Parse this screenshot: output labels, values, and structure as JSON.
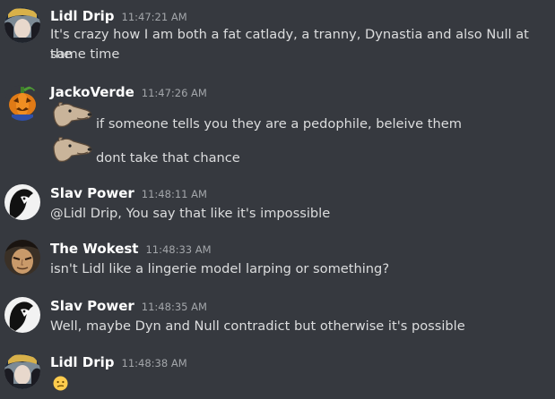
{
  "messages": [
    {
      "author": "Lidl Drip",
      "time": "11:47:21 AM",
      "lines": [
        "It's crazy how I am both a fat catlady, a tranny, Dynastia and also Null at the",
        "same time"
      ]
    },
    {
      "author": "JackoVerde",
      "time": "11:47:26 AM",
      "lines": [
        "if someone tells you they are a pedophile, beleive them",
        "dont take that chance"
      ]
    },
    {
      "author": "Slav Power",
      "time": "11:48:11 AM",
      "lines": [
        "@Lidl Drip, You say that like it's impossible"
      ]
    },
    {
      "author": "The Wokest",
      "time": "11:48:33 AM",
      "lines": [
        "isn't Lidl like a lingerie model larping or something?"
      ]
    },
    {
      "author": "Slav Power",
      "time": "11:48:35 AM",
      "lines": [
        "Well, maybe Dyn and Null contradict but otherwise it's possible"
      ]
    },
    {
      "author": "Lidl Drip",
      "time": "11:48:38 AM",
      "lines": []
    }
  ],
  "icons": {
    "emote": "greyhound-emote-icon",
    "emoji": "confused-face-emoji-icon"
  },
  "colors": {
    "background": "#36393f",
    "username": "#ffffff",
    "timestamp": "#a3a6aa",
    "text": "#dcddde"
  }
}
